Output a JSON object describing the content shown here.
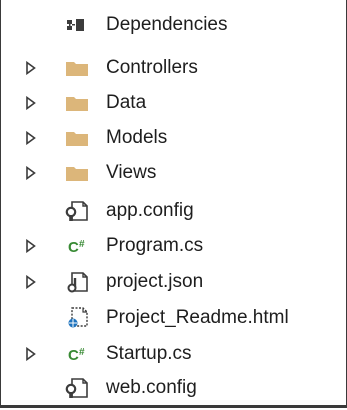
{
  "solution_explorer": {
    "items": [
      {
        "label": "Dependencies",
        "icon": "dependencies-icon",
        "expandable": false
      },
      {
        "label": "Controllers",
        "icon": "folder-icon",
        "expandable": true
      },
      {
        "label": "Data",
        "icon": "folder-icon",
        "expandable": true
      },
      {
        "label": "Models",
        "icon": "folder-icon",
        "expandable": true
      },
      {
        "label": "Views",
        "icon": "folder-icon",
        "expandable": true
      },
      {
        "label": "app.config",
        "icon": "config-file-icon",
        "expandable": false
      },
      {
        "label": "Program.cs",
        "icon": "csharp-file-icon",
        "expandable": true
      },
      {
        "label": "project.json",
        "icon": "json-file-icon",
        "expandable": true
      },
      {
        "label": "Project_Readme.html",
        "icon": "html-file-icon",
        "expandable": false
      },
      {
        "label": "Startup.cs",
        "icon": "csharp-file-icon",
        "expandable": true
      },
      {
        "label": "web.config",
        "icon": "config-file-icon",
        "expandable": false
      }
    ]
  },
  "colors": {
    "folder": "#dcb67a",
    "csharp": "#388a34",
    "html_accent": "#1e73be",
    "text": "#1e1e1e",
    "border": "#3a3a3a"
  }
}
